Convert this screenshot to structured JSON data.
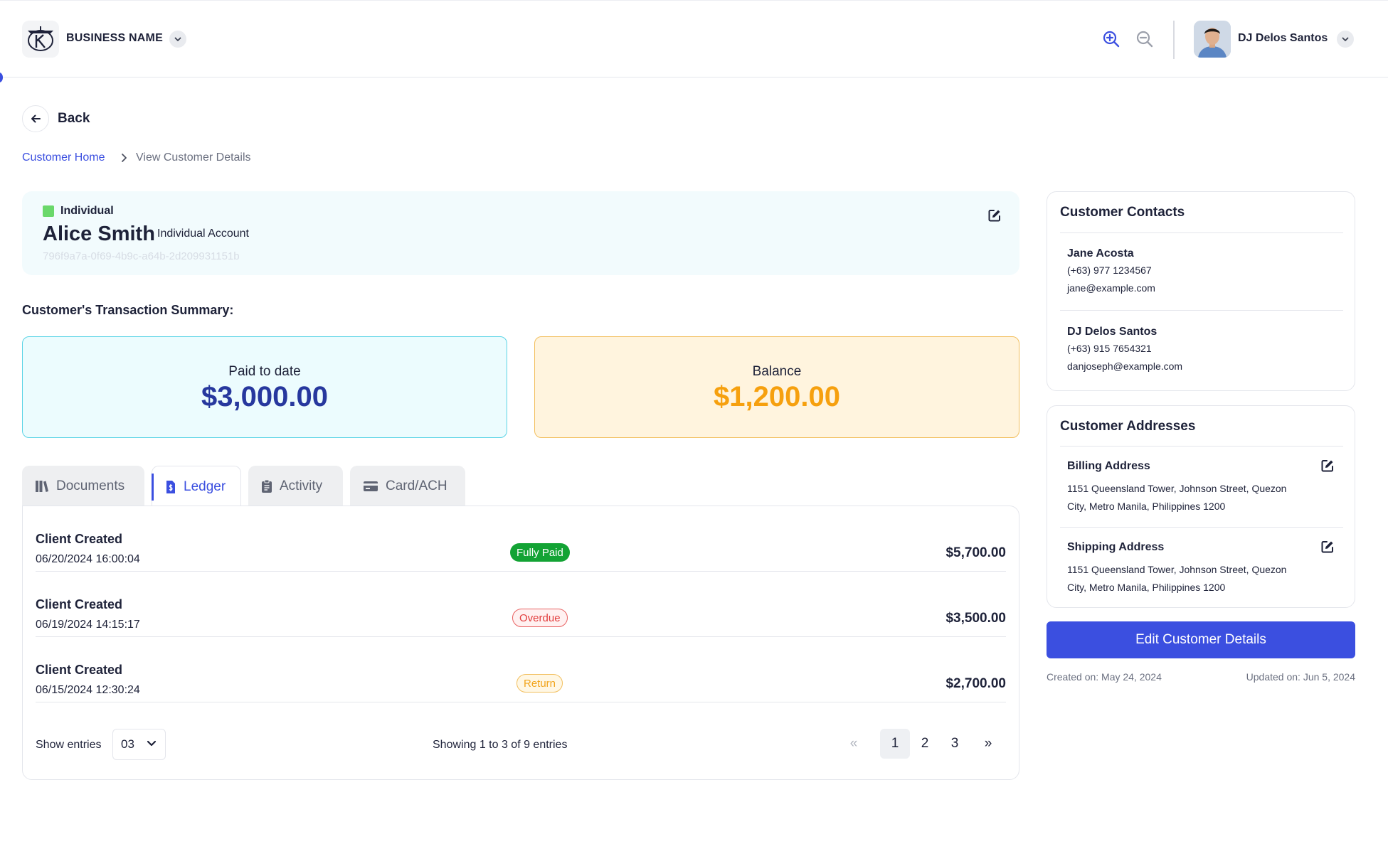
{
  "header": {
    "business_name": "BUSINESS NAME",
    "user_name": "DJ Delos Santos"
  },
  "nav": {
    "back_label": "Back",
    "breadcrumb": [
      "Customer Home",
      "View Customer Details"
    ]
  },
  "customer": {
    "type_label": "Individual",
    "type_color": "#6ad86a",
    "name": "Alice Smith",
    "account_type": "Individual Account",
    "id": "796f9a7a-0f69-4b9c-a64b-2d209931151b"
  },
  "summary": {
    "title": "Customer's Transaction Summary:",
    "paid_label": "Paid to date",
    "paid_value": "$3,000.00",
    "balance_label": "Balance",
    "balance_value": "$1,200.00"
  },
  "tabs": [
    {
      "label": "Documents",
      "icon": "books-icon",
      "active": false
    },
    {
      "label": "Ledger",
      "icon": "invoice-icon",
      "active": true
    },
    {
      "label": "Activity",
      "icon": "clipboard-icon",
      "active": false
    },
    {
      "label": "Card/ACH",
      "icon": "credit-card-icon",
      "active": false
    }
  ],
  "ledger": {
    "rows": [
      {
        "title": "Client Created",
        "date": "06/20/2024 16:00:04",
        "status": "Fully Paid",
        "amount": "$5,700.00"
      },
      {
        "title": "Client Created",
        "date": "06/19/2024 14:15:17",
        "status": "Overdue",
        "amount": "$3,500.00"
      },
      {
        "title": "Client Created",
        "date": "06/15/2024 12:30:24",
        "status": "Return",
        "amount": "$2,700.00"
      }
    ],
    "show_entries_label": "Show entries",
    "entries_value": "03",
    "showing_text": "Showing 1 to 3 of 9 entries",
    "pages": [
      "1",
      "2",
      "3"
    ],
    "prev_symbol": "«",
    "next_symbol": "»",
    "status_colors": {
      "fully_paid": "#13a334",
      "overdue": "#e23d3d",
      "return": "#f2a51e"
    }
  },
  "contacts": {
    "title": "Customer Contacts",
    "items": [
      {
        "name": "Jane Acosta",
        "phone": "(+63) 977 1234567",
        "email": "jane@example.com"
      },
      {
        "name": "DJ Delos Santos",
        "phone": "(+63) 915 7654321",
        "email": "danjoseph@example.com"
      }
    ]
  },
  "addresses": {
    "title": "Customer Addresses",
    "items": [
      {
        "label": "Billing Address",
        "line1": "1151 Queensland Tower, Johnson Street, Quezon",
        "line2": "City, Metro Manila, Philippines 1200"
      },
      {
        "label": "Shipping Address",
        "line1": "1151 Queensland Tower, Johnson Street, Quezon",
        "line2": "City, Metro Manila, Philippines 1200"
      }
    ]
  },
  "footer": {
    "edit_button": "Edit Customer Details",
    "created": "Created on: May 24, 2024",
    "updated": "Updated on: Jun 5, 2024"
  },
  "colors": {
    "accent": "#3b4fe0",
    "paid_value": "#27389e",
    "balance_value": "#f6a00e"
  }
}
